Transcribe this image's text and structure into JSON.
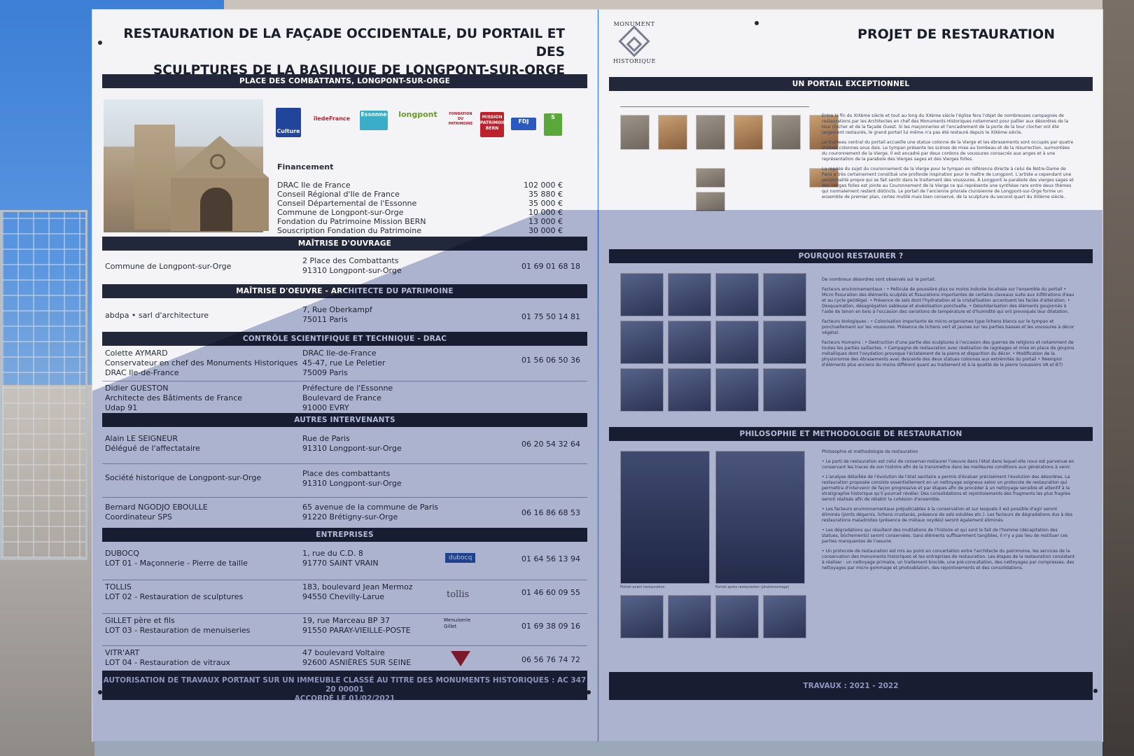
{
  "left": {
    "title_line1": "RESTAURATION DE LA FAÇADE OCCIDENTALE, DU PORTAIL ET DES",
    "title_line2": "SCULPTURES DE LA BASILIQUE DE LONGPONT-SUR-ORGE",
    "place_bar": "PLACE DES COMBATTANTS, LONGPONT-SUR-ORGE",
    "logos": [
      "Culture",
      "îledeFrance",
      "Essonne",
      "longpont",
      "FONDATION DU PATRIMOINE",
      "MISSION PATRIMOINE BERN",
      "FDJ",
      "S"
    ],
    "financement_title": "Financement",
    "financement": [
      {
        "label": "DRAC Ile de France",
        "amount": "102 000 €"
      },
      {
        "label": "Conseil Régional d'Ile de France",
        "amount": "35 880 €"
      },
      {
        "label": "Conseil Départemental de l'Essonne",
        "amount": "35 000 €"
      },
      {
        "label": "Commune de Longpont-sur-Orge",
        "amount": "10 000 €"
      },
      {
        "label": "Fondation du Patrimoine Mission BERN",
        "amount": "13 000 €"
      },
      {
        "label": "Souscription Fondation du Patrimoine",
        "amount": "30 000 €"
      }
    ],
    "moa_bar": "MAÎTRISE D'OUVRAGE",
    "moa": {
      "name": "Commune de Longpont-sur-Orge",
      "addr1": "2 Place des Combattants",
      "addr2": "91310 Longpont-sur-Orge",
      "phone": "01 69 01 68 18"
    },
    "moe_bar": "MAÎTRISE D'OEUVRE - ARCHITECTE DU PATRIMOINE",
    "moe": {
      "name": "abdpa • sarl d'architecture",
      "addr1": "7, Rue Oberkampf",
      "addr2": "75011 Paris",
      "phone": "01 75 50 14 81"
    },
    "cst_bar": "CONTRÔLE SCIENTIFIQUE ET TECHNIQUE - DRAC",
    "cst": [
      {
        "n1": "Colette AYMARD",
        "n2": "Conservateur en chef des Monuments Historiques",
        "n3": "DRAC Ile-de-France",
        "a1": "DRAC Ile-de-France",
        "a2": "45-47, rue Le Peletier",
        "a3": "75009 Paris",
        "phone": "01 56 06 50 36"
      },
      {
        "n1": "Didier GUESTON",
        "n2": "Architecte des Bâtiments de France",
        "n3": "Udap 91",
        "a1": "Préfecture de l'Essonne",
        "a2": "Boulevard de France",
        "a3": "91000 EVRY",
        "phone": ""
      }
    ],
    "autres_bar": "AUTRES INTERVENANTS",
    "autres": [
      {
        "n1": "Alain LE SEIGNEUR",
        "n2": "Délégué de l'affectataire",
        "a1": "Rue de Paris",
        "a2": "91310 Longpont-sur-Orge",
        "phone": "06 20 54 32 64"
      },
      {
        "n1": "Société historique de Longpont-sur-Orge",
        "n2": "",
        "a1": "Place des combattants",
        "a2": "91310 Longpont-sur-Orge",
        "phone": ""
      },
      {
        "n1": "Bernard NGODJO EBOULLE",
        "n2": "Coordinateur SPS",
        "a1": "65 avenue de la commune de Paris",
        "a2": "91220 Brétigny-sur-Orge",
        "phone": "06 16 86 68 53"
      }
    ],
    "ent_bar": "ENTREPRISES",
    "entreprises": [
      {
        "n1": "DUBOCQ",
        "n2": "LOT 01 - Maçonnerie - Pierre de taille",
        "a1": "1, rue du C.D. 8",
        "a2": "91770 SAINT VRAIN",
        "logo": "dubocq",
        "phone": "01 64 56 13 94"
      },
      {
        "n1": "TOLLIS",
        "n2": "LOT 02 - Restauration de sculptures",
        "a1": "183, boulevard Jean Mermoz",
        "a2": "94550 Chevilly-Larue",
        "logo": "tollis",
        "phone": "01 46 60 09 55"
      },
      {
        "n1": "GILLET père et fils",
        "n2": "LOT 03 - Restauration de menuiseries",
        "a1": "19, rue Marceau BP 37",
        "a2": "91550 PARAY-VIEILLE-POSTE",
        "logo": "Menuiserie Gillet",
        "phone": "01 69 38 09 16"
      },
      {
        "n1": "VITR'ART",
        "n2": "LOT 04 - Restauration de vitraux",
        "a1": "47 boulevard Voltaire",
        "a2": "92600 ASNIÈRES SUR SEINE",
        "logo": "",
        "phone": "06 56 76 74 72"
      }
    ],
    "footer_line1": "AUTORISATION DE TRAVAUX PORTANT SUR UN IMMEUBLE CLASSÉ AU TITRE DES MONUMENTS HISTORIQUES : AC 347 20 00001",
    "footer_line2": "ACCORDÉ LE 01/02/2021"
  },
  "right": {
    "logo_top": "MONUMENT",
    "logo_bottom": "HISTORIQUE",
    "title": "PROJET DE RESTAURATION",
    "portail_bar": "UN PORTAIL EXCEPTIONNEL",
    "pourquoi_bar": "POURQUOI RESTAURER ?",
    "philo_bar": "PHILOSOPHIE ET METHODOLOGIE DE RESTAURATION",
    "travaux": "TRAVAUX : 2021 - 2022",
    "portail_text": [
      "Entre la fin du XIXème siècle et tout au long du XXème siècle l'église fera l'objet de nombreuses campagnes de restaurations par les Architectes en chef des Monuments Historiques notamment pour pallier aux désordres de la tour clocher et de la façade Ouest. Si les maçonneries et l'encadrement de la porte de la tour clocher ont été largement restaurés, le grand portail lui même n'a pas été restauré depuis le XIXème siècle.",
      "Le trumeau central du portail accueille une statue colonne de la Vierge et les ébrasements sont occupés par quatre statues colonnes sous dais. Le tympan présente les scènes de mise au tombeau et de la résurrection, surmontées du couronnement de la Vierge. Il est encadré par deux cordons de voussures consacrés aux anges et à une représentation de la parabole des Vierges sages et des Vierges folles.",
      "La reprise du sujet du couronnement de la Vierge pour le tympan en référence directe à celui de Notre-Dame de Paris a très certainement constitué une profonde inspiration pour le maître de Longpont. L'artiste a cependant une personnalité propre qui se fait sentir dans le traitement des voussures. À Longpont la parabole des vierges sages et des vierges folles est jointe au Couronnement de la Vierge ce qui représente une synthèse rare entre deux thèmes qui normalement restent distincts. Le portail de l'ancienne priorale clunisienne de Longpont-sur-Orge forme un ensemble de premier plan, certes mutilé mais bien conservé, de la sculpture du second quart du XIIIème siècle."
    ],
    "pourquoi_text": [
      "De nombreux désordres sont observés sur le portail.",
      "Facteurs environnementaux : • Pellicule de poussière plus ou moins indurée localisée sur l'ensemble du portail • Micro fissuration des éléments sculptés et fissurations importantes de certains claveaux suite aux infiltrations d'eau et au cycle gel/dégel. • Présence de sels dont l'hydratation et la cristallisation accentuent les faciès d'altération. • Desquamation, désagrégation sableuse et alvéolisation ponctuelle. • Désolidarisation des éléments goujonnés à l'aide de tenon en bois à l'occasion des variations de température et d'humidité qui ont provoqués leur dilatation.",
      "Facteurs biologiques : • Colonisation importante de micro-organismes type lichens blancs sur le tympan et ponctuellement sur les voussures. Présence de lichens vert et jaunes sur les parties basses et les voussures à décor végétal.",
      "Facteurs Humains : • Destruction d'une partie des sculptures à l'occasion des guerres de religions et notamment de toutes les parties saillantes. • Campagne de restauration avec réalisation de ragréages et mise en place de goujons métalliques dont l'oxydation provoque l'éclatement de la pierre et disparition du décor. • Modification de la physionomie des ébrasements avec descente des deux statues colonnes aux extrémités du portail • Réemploi d'éléments plus anciens du moins différent quant au traitement et à la qualité de la pierre (voussoirs VA et B7)"
    ],
    "philo_text": [
      "Philosophie et méthodologie de restauration",
      "• Le parti de restauration est celui de conserver-restaurer l'oeuvre dans l'état dans lequel elle nous est parvenue en conservant les traces de son histoire afin de la transmettre dans les meilleures conditions aux générations à venir.",
      "• L'analyse détaillée de l'évolution de l'état sanitaire a permis d'évaluer précisément l'évolution des désordres. La restauration proposée consiste essentiellement en un nettoyage soigneux selon un protocole de restauration qui permettra d'intervenir de façon progressive et par étapes afin de procéder à un nettoyage sensible et attentif à la stratigraphie historique qu'il pourrait révéler. Des consolidations et rejointoiements des fragments les plus fragiles seront réalisés afin de rétablir la cohésion d'ensemble.",
      "• Les facteurs environnementaux préjudiciables à la conservation et sur lesquels il est possible d'agir seront éliminés (joints dégarnis, lichens crustacés, présence de sels solubles etc.). Les facteurs de dégradations dus à des restaurations maladroites (présence de métaux oxydés) seront également éliminés.",
      "• Les dégradations qui résultent des mutilations de l'histoire et qui sont le fait de l'homme (décapitation des statues, bûchements) seront conservées. Sans éléments suffisamment tangibles, il n'y a pas lieu de restituer ces parties manquantes de l'oeuvre.",
      "• Un protocole de restauration est mis au point en concertation entre l'architecte du patrimoine, les services de la conservation des monuments historiques et les entreprises de restauration. Les étapes de la restauration consistent à réaliser : un nettoyage primaire, un traitement biocide, une pré-consultation, des nettoyages par compresses, des nettoyages par micro-gommage et photoablation, des rejointoiements et des consolidations."
    ],
    "caption_before": "Portail avant restauration",
    "caption_after": "Portail après restauration (photomontage)"
  },
  "colors": {
    "bar": "#23273a",
    "panel": "#f4f4f6",
    "text": "#2a2d3a"
  }
}
